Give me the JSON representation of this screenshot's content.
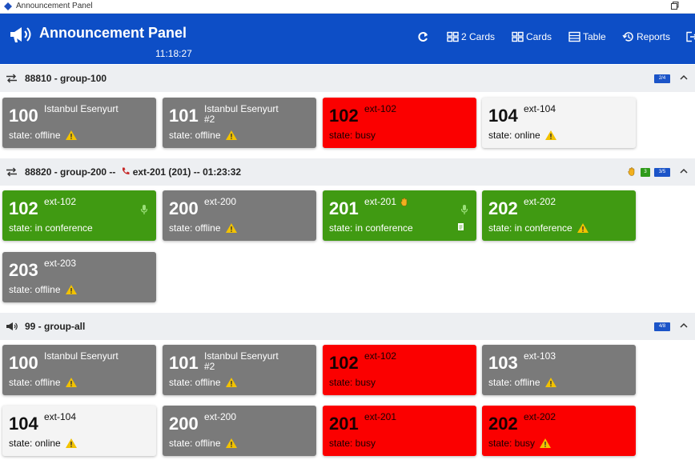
{
  "window": {
    "title": "Announcement Panel"
  },
  "header": {
    "title": "Announcement Panel",
    "clock": "11:18:27"
  },
  "nav": [
    {
      "label": "",
      "icon": "refresh-icon"
    },
    {
      "label": "2 Cards",
      "icon": "cards-icon"
    },
    {
      "label": "Cards",
      "icon": "cards-icon"
    },
    {
      "label": "Table",
      "icon": "table-icon"
    },
    {
      "label": "Reports",
      "icon": "history-icon"
    }
  ],
  "groups": [
    {
      "title": "88810 - group-100",
      "icon": "transfer-icon",
      "badges": [
        {
          "text": "2/4",
          "color": "#1b54c8"
        }
      ],
      "cards": [
        {
          "number": "100",
          "name": "Istanbul Esenyurt",
          "state": "state: offline",
          "status": "offline",
          "warning": true
        },
        {
          "number": "101",
          "name": "Istanbul Esenyurt\n#2",
          "state": "state: offline",
          "status": "offline",
          "warning": true
        },
        {
          "number": "102",
          "name": "ext-102",
          "state": "state: busy",
          "status": "busy",
          "warning": false
        },
        {
          "number": "104",
          "name": "ext-104",
          "state": "state: online",
          "status": "online",
          "warning": true
        }
      ]
    },
    {
      "title": "88820 - group-200 -- ",
      "title_call": "ext-201 (201) -- 01:23:32",
      "icon": "transfer-icon",
      "badges": [
        {
          "text": "3",
          "color": "#2e9a1a"
        },
        {
          "text": "3/5",
          "color": "#1b54c8"
        }
      ],
      "cards": [
        {
          "number": "102",
          "name": "ext-102",
          "state": "state: in conference",
          "status": "conference",
          "warning": false,
          "mic": true
        },
        {
          "number": "200",
          "name": "ext-200",
          "state": "state: offline",
          "status": "offline",
          "warning": true
        },
        {
          "number": "201",
          "name": "ext-201",
          "state": "state: in conference",
          "status": "conference",
          "warning": false,
          "mic": true,
          "hand": true,
          "doc": true
        },
        {
          "number": "202",
          "name": "ext-202",
          "state": "state: in conference",
          "status": "conference",
          "warning": true
        },
        {
          "number": "203",
          "name": "ext-203",
          "state": "state: offline",
          "status": "offline",
          "warning": true
        }
      ]
    },
    {
      "title": "99 - group-all",
      "icon": "megaphone-icon",
      "badges": [
        {
          "text": "4/8",
          "color": "#1b54c8"
        }
      ],
      "cards": [
        {
          "number": "100",
          "name": "Istanbul Esenyurt",
          "state": "state: offline",
          "status": "offline",
          "warning": true
        },
        {
          "number": "101",
          "name": "Istanbul Esenyurt\n#2",
          "state": "state: offline",
          "status": "offline",
          "warning": true
        },
        {
          "number": "102",
          "name": "ext-102",
          "state": "state: busy",
          "status": "busy",
          "warning": false
        },
        {
          "number": "103",
          "name": "ext-103",
          "state": "state: offline",
          "status": "offline",
          "warning": true
        },
        {
          "number": "104",
          "name": "ext-104",
          "state": "state: online",
          "status": "online",
          "warning": true
        },
        {
          "number": "200",
          "name": "ext-200",
          "state": "state: offline",
          "status": "offline",
          "warning": true
        },
        {
          "number": "201",
          "name": "ext-201",
          "state": "state: busy",
          "status": "busy",
          "warning": false
        },
        {
          "number": "202",
          "name": "ext-202",
          "state": "state: busy",
          "status": "busy",
          "warning": true
        }
      ]
    }
  ],
  "colors": {
    "header": "#0d4ec6",
    "offline": "#7a7a7a",
    "busy": "#fb0000",
    "conference": "#409a12",
    "online": "#f4f4f4",
    "warning": "#f2c200"
  }
}
